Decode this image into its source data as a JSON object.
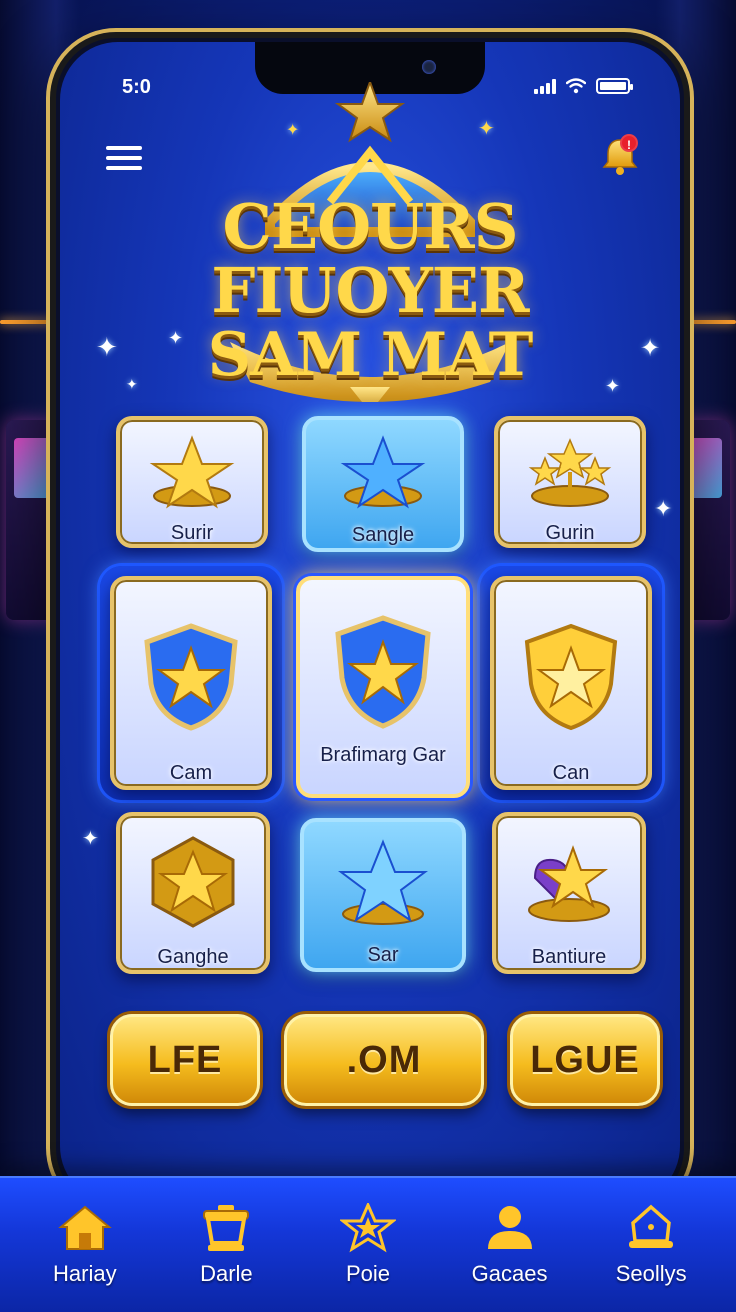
{
  "status_bar": {
    "time": "5:0"
  },
  "header": {
    "logo_lines": [
      "CEOURS",
      "FIUOYER",
      "SAM MAT"
    ],
    "has_notification": true,
    "notification_badge": "!"
  },
  "cards": [
    {
      "label": "Surir",
      "icon": "gold-star-pedestal-icon",
      "style": "light"
    },
    {
      "label": "Sangle",
      "icon": "blue-star-pedestal-icon",
      "style": "blue"
    },
    {
      "label": "Gurin",
      "icon": "triple-star-pedestal-icon",
      "style": "light"
    },
    {
      "label": "Cam",
      "icon": "blue-shield-star-icon",
      "style": "light"
    },
    {
      "label": "Brafimarg Gar",
      "icon": "blue-shield-star-icon",
      "style": "selected"
    },
    {
      "label": "Can",
      "icon": "gold-shield-star-icon",
      "style": "light"
    },
    {
      "label": "Ganghe",
      "icon": "gold-hexagon-star-icon",
      "style": "light"
    },
    {
      "label": "Sar",
      "icon": "blue-crystal-star-icon",
      "style": "blue"
    },
    {
      "label": "Bantiure",
      "icon": "star-gem-pedestal-icon",
      "style": "light"
    }
  ],
  "actions": [
    {
      "label": "LFE"
    },
    {
      "label": ".OM"
    },
    {
      "label": "LGUE"
    }
  ],
  "bottom_nav": [
    {
      "label": "Hariay",
      "icon": "home-icon"
    },
    {
      "label": "Darle",
      "icon": "pot-icon"
    },
    {
      "label": "Poie",
      "icon": "star-icon"
    },
    {
      "label": "Gacaes",
      "icon": "profile-icon"
    },
    {
      "label": "Seollys",
      "icon": "bell-outline-icon"
    }
  ],
  "colors": {
    "gold": "#f5bc1e",
    "royal_blue": "#1536b8",
    "accent_blue": "#3fa6f0"
  }
}
